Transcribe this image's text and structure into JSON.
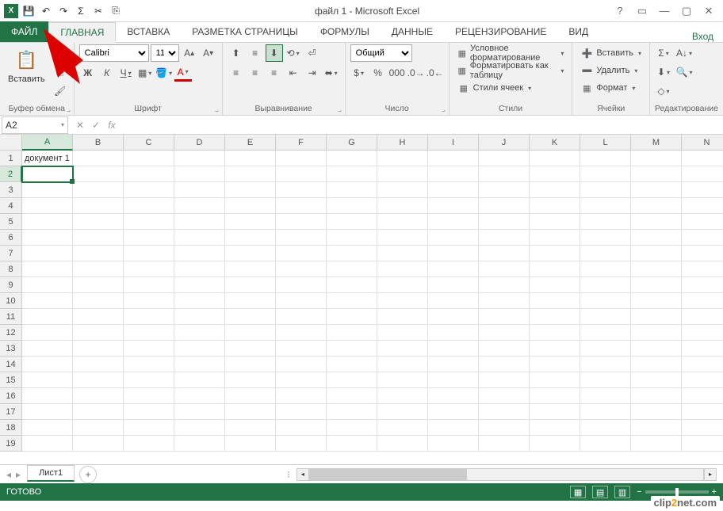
{
  "title": "файл 1 - Microsoft Excel",
  "qat_icons": [
    "save",
    "undo",
    "redo",
    "sum",
    "cut",
    "copy"
  ],
  "signin": "Вход",
  "tabs": {
    "file": "ФАЙЛ",
    "items": [
      "ГЛАВНАЯ",
      "ВСТАВКА",
      "РАЗМЕТКА СТРАНИЦЫ",
      "ФОРМУЛЫ",
      "ДАННЫЕ",
      "РЕЦЕНЗИРОВАНИЕ",
      "ВИД"
    ],
    "active": "ГЛАВНАЯ"
  },
  "ribbon": {
    "clipboard": {
      "paste": "Вставить",
      "label": "Буфер обмена"
    },
    "font": {
      "name": "Calibri",
      "size": "11",
      "bold": "Ж",
      "italic": "К",
      "underline": "Ч",
      "label": "Шрифт"
    },
    "alignment": {
      "label": "Выравнивание"
    },
    "number": {
      "format": "Общий",
      "label": "Число"
    },
    "styles": {
      "cond": "Условное форматирование",
      "table": "Форматировать как таблицу",
      "cellstyles": "Стили ячеек",
      "label": "Стили"
    },
    "cells": {
      "insert": "Вставить",
      "delete": "Удалить",
      "format": "Формат",
      "label": "Ячейки"
    },
    "editing": {
      "label": "Редактирование"
    }
  },
  "namebox": "A2",
  "columns": [
    "A",
    "B",
    "C",
    "D",
    "E",
    "F",
    "G",
    "H",
    "I",
    "J",
    "K",
    "L",
    "M",
    "N"
  ],
  "rows": [
    1,
    2,
    3,
    4,
    5,
    6,
    7,
    8,
    9,
    10,
    11,
    12,
    13,
    14,
    15,
    16,
    17,
    18,
    19
  ],
  "active_col": "A",
  "active_row": 2,
  "cell_data": {
    "A1": "документ 1"
  },
  "sheet": {
    "name": "Лист1"
  },
  "status": "ГОТОВО",
  "watermark": {
    "a": "clip",
    "b": "2",
    "c": "net",
    "d": ".com"
  }
}
